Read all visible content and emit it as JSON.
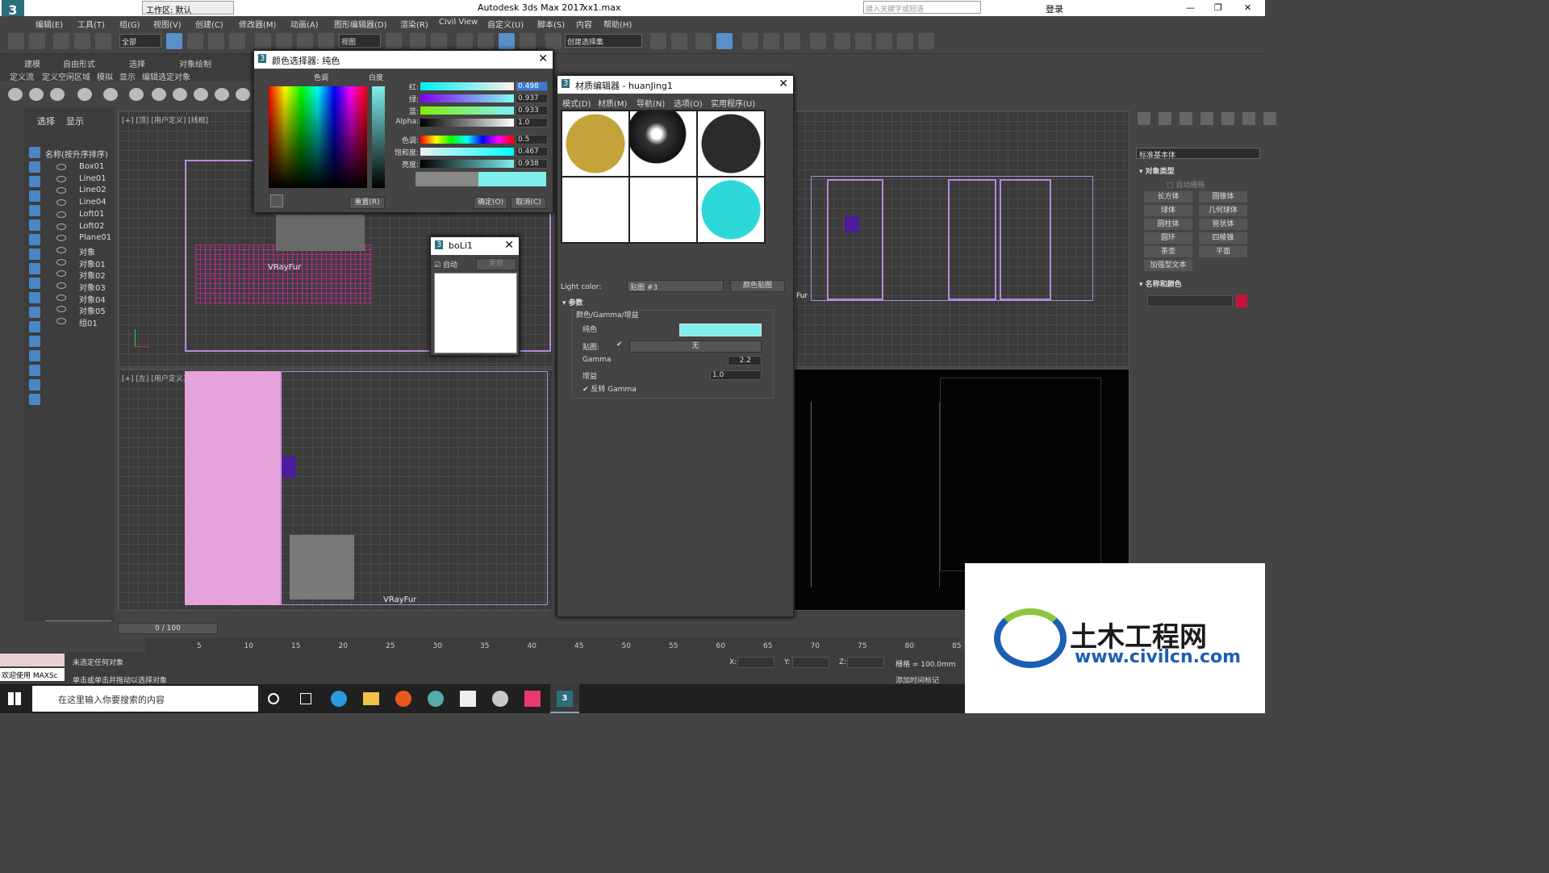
{
  "window": {
    "app_title": "Autodesk 3ds Max 2017",
    "file_name": "xx1.max",
    "workspace": "工作区: 默认",
    "search_placeholder": "键入关键字或短语",
    "login": "登录"
  },
  "menu": [
    "编辑(E)",
    "工具(T)",
    "组(G)",
    "视图(V)",
    "创建(C)",
    "修改器(M)",
    "动画(A)",
    "图形编辑器(D)",
    "渲染(R)",
    "Civil View",
    "自定义(U)",
    "脚本(S)",
    "内容",
    "帮助(H)"
  ],
  "toolbar": {
    "filter": "全部",
    "ref_coord": "视图",
    "selection_set": "创建选择集"
  },
  "ribbon": {
    "tabs": [
      "建模",
      "自由形式",
      "选择",
      "对象绘制"
    ],
    "subtabs": [
      "定义流",
      "定义空闲区域",
      "模拟",
      "显示",
      "编辑选定对象"
    ]
  },
  "scene_explorer": {
    "tabs": [
      "选择",
      "显示"
    ],
    "header": "名称(按升序排序)",
    "items": [
      "Box01",
      "Line01",
      "Line02",
      "Line04",
      "Loft01",
      "Loft02",
      "Plane01",
      "对象",
      "对象01",
      "对象02",
      "对象03",
      "对象04",
      "对象05",
      "组01"
    ]
  },
  "viewports": {
    "top": "[+] [顶] [用户定义] [线框]",
    "left": "[+] [左] [用户定义] [线框]",
    "vray_label_top": "VRayFur",
    "vray_label_left": "VRayFur",
    "vray_label_right": "Fur"
  },
  "color_picker": {
    "title": "颜色选择器: 纯色",
    "hue_label": "色调",
    "white_label": "白度",
    "rows": [
      {
        "label": "红:",
        "value": "0.498"
      },
      {
        "label": "绿:",
        "value": "0.937"
      },
      {
        "label": "蓝:",
        "value": "0.933"
      },
      {
        "label": "Alpha:",
        "value": "1.0"
      },
      {
        "label": "色调:",
        "value": "0.5"
      },
      {
        "label": "饱和度:",
        "value": "0.467"
      },
      {
        "label": "亮度:",
        "value": "0.938"
      }
    ],
    "reset": "重置(R)",
    "ok": "确定(O)",
    "cancel": "取消(C)",
    "color": "#7fefee"
  },
  "boli": {
    "title": "boLi1",
    "auto": "自动",
    "update": "更新"
  },
  "material_editor": {
    "title": "材质编辑器 - huanJing1",
    "menu": [
      "模式(D)",
      "材质(M)",
      "导航(N)",
      "选项(O)",
      "实用程序(U)"
    ],
    "light_color_label": "Light color:",
    "map_name": "贴图 #3",
    "map_type": "颜色贴图",
    "rollout": "参数",
    "group": "颜色/Gamma/增益",
    "solid_label": "纯色",
    "map_label": "贴图:",
    "map_value": "无",
    "gamma_label": "Gamma",
    "gamma_value": "2.2",
    "gain_label": "增益",
    "gain_value": "1.0",
    "invert_gamma": "反转 Gamma"
  },
  "command_panel": {
    "dropdown": "标准基本体",
    "section_object_type": "对象类型",
    "autogrid": "自动栅格",
    "buttons": [
      "长方体",
      "圆锥体",
      "球体",
      "几何球体",
      "圆柱体",
      "管状体",
      "圆环",
      "四棱锥",
      "茶壶",
      "平面",
      "加强型文本"
    ],
    "section_name_color": "名称和颜色",
    "object_color": "#c8143c"
  },
  "timeline": {
    "frame": "0 / 100",
    "ticks": [
      "5",
      "10",
      "15",
      "20",
      "25",
      "30",
      "35",
      "40",
      "45",
      "50",
      "55",
      "60",
      "65",
      "70",
      "75",
      "80",
      "85"
    ]
  },
  "status": {
    "welcome": "欢迎使用 MAXSc",
    "line1": "未选定任何对象",
    "line2": "单击或单击并拖动以选择对象",
    "x_label": "X:",
    "y_label": "Y:",
    "z_label": "Z:",
    "grid": "栅格 = 100.0mm",
    "add_tag": "添加时间标记"
  },
  "taskbar": {
    "search": "在这里输入你要搜索的内容"
  },
  "watermark": {
    "brand": "土木工程网",
    "url": "www.civilcn.com"
  }
}
